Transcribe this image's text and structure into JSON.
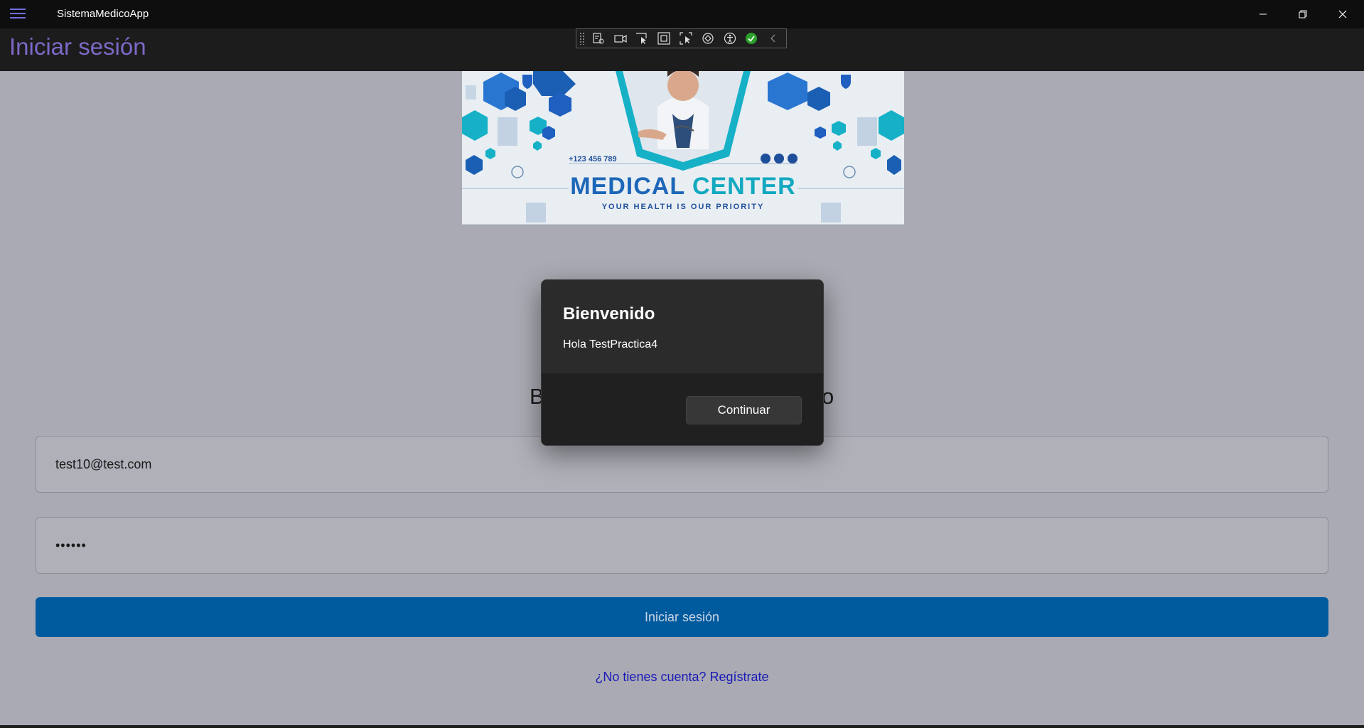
{
  "window": {
    "app_title": "SistemaMedicoApp"
  },
  "header": {
    "page_title": "Iniciar sesión"
  },
  "banner": {
    "phone": "+123 456 789",
    "title_part1": "MEDICAL ",
    "title_part2": "CENTER",
    "tagline": "YOUR HEALTH IS OUR PRIORITY"
  },
  "form": {
    "welcome_left": "B",
    "welcome_right": "o",
    "email_value": "test10@test.com",
    "password_value": "••••••",
    "login_label": "Iniciar sesión",
    "register_link": "¿No tienes cuenta? Regístrate"
  },
  "dialog": {
    "title": "Bienvenido",
    "message": "Hola TestPractica4",
    "continue_label": "Continuar"
  },
  "colors": {
    "accent": "#005a9e",
    "title_purple": "#7e68c6",
    "link_blue": "#1a1ab8"
  }
}
